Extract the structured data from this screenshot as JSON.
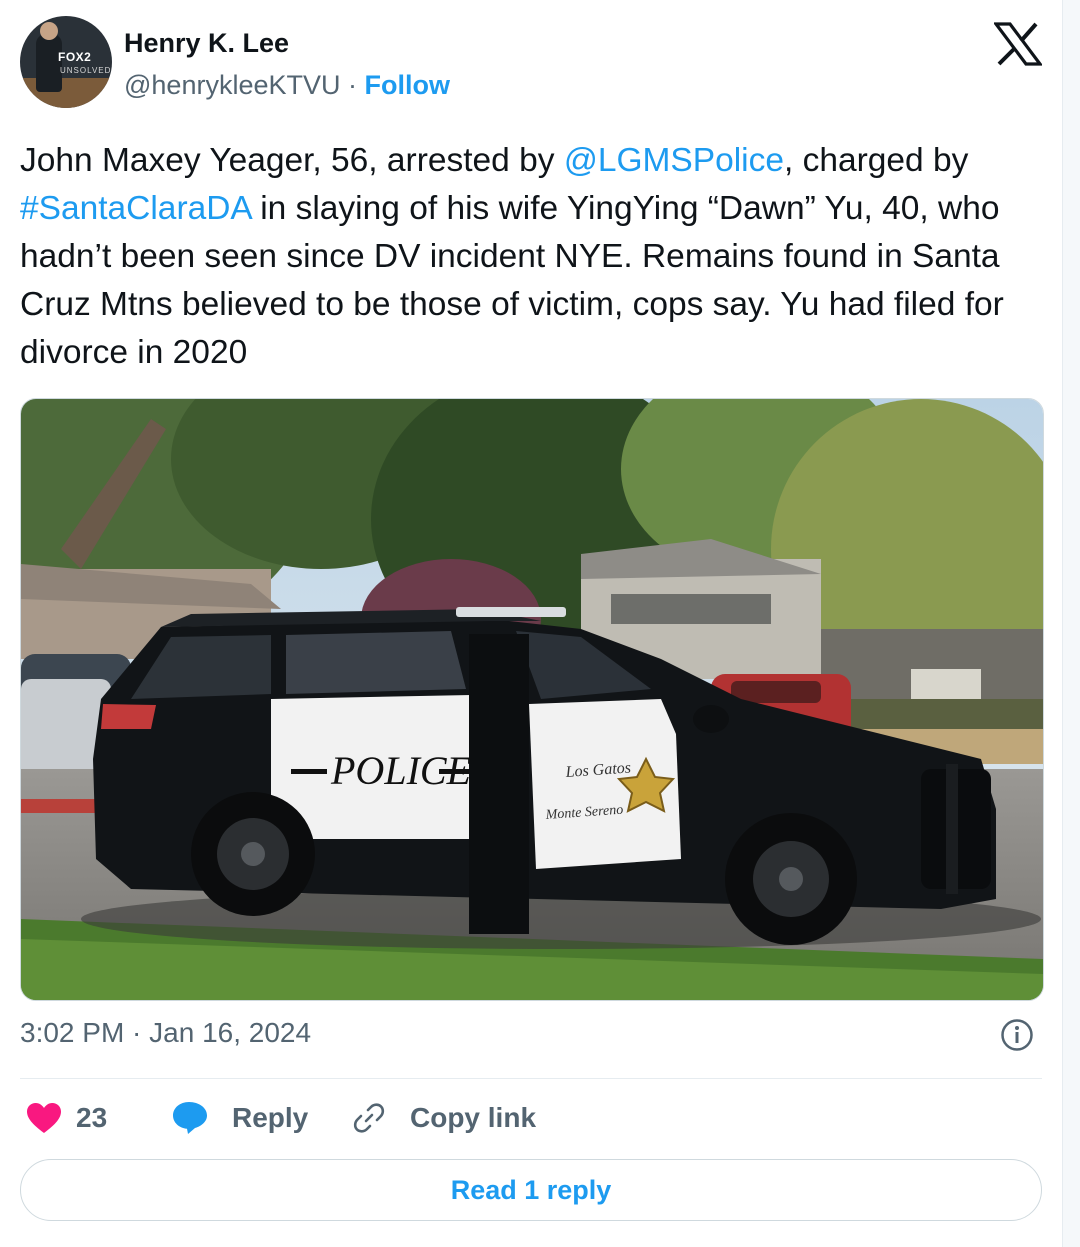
{
  "author": {
    "name": "Henry K. Lee",
    "handle": "@henrykleeKTVU",
    "separator": "·",
    "follow_label": "Follow",
    "avatar_logo_text": "FOX2",
    "avatar_sub_text": "UNSOLVED"
  },
  "brand_icon": "x-logo-icon",
  "tweet": {
    "text_1": "John Maxey Yeager, 56, arrested by ",
    "mention": "@LGMSPolice",
    "text_2": ", charged by ",
    "hashtag": "#SantaClaraDA",
    "text_3": " in slaying of his wife YingYing “Dawn” Yu, 40, who hadn’t been seen since DV incident NYE. Remains found in Santa Cruz Mtns believed to be those of victim, cops say. Yu had filed for divorce in 2020"
  },
  "media": {
    "door_text": "POLICE",
    "door_text_2": "Los Gatos",
    "door_text_3": "Monte Sereno"
  },
  "meta": {
    "timestamp": "3:02 PM · Jan 16, 2024",
    "info_icon": "info-icon"
  },
  "actions": {
    "like_count": "23",
    "reply_label": "Reply",
    "copy_label": "Copy link"
  },
  "read_replies_label": "Read 1 reply",
  "colors": {
    "accent": "#1d9bf0",
    "like": "#f91880",
    "secondary_text": "#536471"
  }
}
